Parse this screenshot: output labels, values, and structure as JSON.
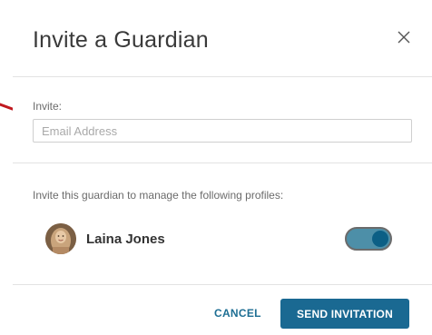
{
  "dialog": {
    "title": "Invite a Guardian",
    "close_icon": "close-icon"
  },
  "invite": {
    "label": "Invite:",
    "email_placeholder": "Email Address",
    "email_value": ""
  },
  "profiles": {
    "heading": "Invite this guardian to manage the following profiles:",
    "items": [
      {
        "name": "Laina Jones",
        "enabled": true
      }
    ]
  },
  "footer": {
    "cancel_label": "CANCEL",
    "send_label": "SEND INVITATION"
  },
  "colors": {
    "primary": "#1a6992",
    "toggle_track": "#4d8fa8",
    "toggle_knob": "#0c5f85",
    "annotation_arrow": "#c0191f"
  }
}
